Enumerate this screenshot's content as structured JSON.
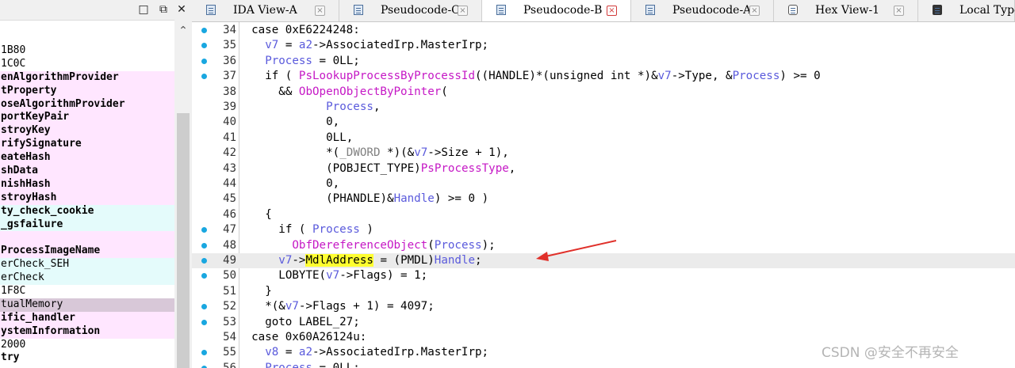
{
  "left_panel": {
    "functions": [
      {
        "name": "1B80",
        "bold": false,
        "bg": ""
      },
      {
        "name": "1C0C",
        "bold": false,
        "bg": ""
      },
      {
        "name": "enAlgorithmProvider",
        "bold": true,
        "bg": "pink"
      },
      {
        "name": "tProperty",
        "bold": true,
        "bg": "pink"
      },
      {
        "name": "oseAlgorithmProvider",
        "bold": true,
        "bg": "pink"
      },
      {
        "name": "portKeyPair",
        "bold": true,
        "bg": "pink"
      },
      {
        "name": "stroyKey",
        "bold": true,
        "bg": "pink"
      },
      {
        "name": "rifySignature",
        "bold": true,
        "bg": "pink"
      },
      {
        "name": "eateHash",
        "bold": true,
        "bg": "pink"
      },
      {
        "name": "shData",
        "bold": true,
        "bg": "pink"
      },
      {
        "name": "nishHash",
        "bold": true,
        "bg": "pink"
      },
      {
        "name": "stroyHash",
        "bold": true,
        "bg": "pink"
      },
      {
        "name": "ty_check_cookie",
        "bold": true,
        "bg": "cyan"
      },
      {
        "name": "_gsfailure",
        "bold": true,
        "bg": "cyan"
      },
      {
        "name": "",
        "bold": true,
        "bg": "pink"
      },
      {
        "name": "ProcessImageName",
        "bold": true,
        "bg": "pink"
      },
      {
        "name": "erCheck_SEH",
        "bold": false,
        "bg": "cyan"
      },
      {
        "name": "erCheck",
        "bold": false,
        "bg": "cyan"
      },
      {
        "name": "1F8C",
        "bold": false,
        "bg": ""
      },
      {
        "name": "tualMemory",
        "bold": false,
        "bg": "sel"
      },
      {
        "name": "ific_handler",
        "bold": true,
        "bg": "pink"
      },
      {
        "name": "ystemInformation",
        "bold": true,
        "bg": "pink"
      },
      {
        "name": "2000",
        "bold": false,
        "bg": ""
      },
      {
        "name": "try",
        "bold": true,
        "bg": ""
      }
    ]
  },
  "tabs": [
    {
      "label": "IDA View-A",
      "icon": "ida-view-icon",
      "active": false,
      "close_red": false
    },
    {
      "label": "Pseudocode-C",
      "icon": "pseudocode-icon",
      "active": false,
      "close_red": false
    },
    {
      "label": "Pseudocode-B",
      "icon": "pseudocode-icon",
      "active": true,
      "close_red": true
    },
    {
      "label": "Pseudocode-A",
      "icon": "pseudocode-icon",
      "active": false,
      "close_red": false
    },
    {
      "label": "Hex View-1",
      "icon": "hex-view-icon",
      "active": false,
      "close_red": false
    },
    {
      "label": "Local Types",
      "icon": "local-types-icon",
      "active": false,
      "close_red": false
    }
  ],
  "code_lines": [
    {
      "n": "34",
      "bp": true,
      "indent": 2,
      "tokens": [
        [
          "",
          "case 0xE6224248:"
        ]
      ]
    },
    {
      "n": "35",
      "bp": true,
      "indent": 4,
      "tokens": [
        [
          "v",
          "v7"
        ],
        [
          "",
          " = "
        ],
        [
          "v",
          "a2"
        ],
        [
          "",
          "->AssociatedIrp.MasterIrp;"
        ]
      ]
    },
    {
      "n": "36",
      "bp": true,
      "indent": 4,
      "tokens": [
        [
          "v",
          "Process"
        ],
        [
          "",
          " = 0LL;"
        ]
      ]
    },
    {
      "n": "37",
      "bp": true,
      "indent": 4,
      "tokens": [
        [
          "",
          "if ( "
        ],
        [
          "p",
          "PsLookupProcessByProcessId"
        ],
        [
          "",
          "((HANDLE)*(unsigned int *)&"
        ],
        [
          "v",
          "v7"
        ],
        [
          "",
          "->Type, &"
        ],
        [
          "v",
          "Process"
        ],
        [
          "",
          ") >= 0"
        ]
      ]
    },
    {
      "n": "38",
      "bp": false,
      "indent": 6,
      "tokens": [
        [
          "",
          "&& "
        ],
        [
          "p",
          "ObOpenObjectByPointer"
        ],
        [
          "",
          "("
        ]
      ]
    },
    {
      "n": "39",
      "bp": false,
      "indent": 13,
      "tokens": [
        [
          "v",
          "Process"
        ],
        [
          "",
          ","
        ]
      ]
    },
    {
      "n": "40",
      "bp": false,
      "indent": 13,
      "tokens": [
        [
          "",
          "0,"
        ]
      ]
    },
    {
      "n": "41",
      "bp": false,
      "indent": 13,
      "tokens": [
        [
          "",
          "0LL,"
        ]
      ]
    },
    {
      "n": "42",
      "bp": false,
      "indent": 13,
      "tokens": [
        [
          "",
          "*("
        ],
        [
          "g",
          "_DWORD"
        ],
        [
          "",
          " *)(&"
        ],
        [
          "v",
          "v7"
        ],
        [
          "",
          "->Size + 1),"
        ]
      ]
    },
    {
      "n": "43",
      "bp": false,
      "indent": 13,
      "tokens": [
        [
          "",
          "(POBJECT_TYPE)"
        ],
        [
          "p",
          "PsProcessType"
        ],
        [
          "",
          ","
        ]
      ]
    },
    {
      "n": "44",
      "bp": false,
      "indent": 13,
      "tokens": [
        [
          "",
          "0,"
        ]
      ]
    },
    {
      "n": "45",
      "bp": false,
      "indent": 13,
      "tokens": [
        [
          "",
          "(PHANDLE)&"
        ],
        [
          "v",
          "Handle"
        ],
        [
          "",
          ") >= 0 )"
        ]
      ]
    },
    {
      "n": "46",
      "bp": false,
      "indent": 4,
      "tokens": [
        [
          "",
          "{"
        ]
      ]
    },
    {
      "n": "47",
      "bp": true,
      "indent": 6,
      "tokens": [
        [
          "",
          "if ( "
        ],
        [
          "v",
          "Process"
        ],
        [
          "",
          " )"
        ]
      ]
    },
    {
      "n": "48",
      "bp": true,
      "indent": 8,
      "tokens": [
        [
          "p",
          "ObfDereferenceObject"
        ],
        [
          "",
          "("
        ],
        [
          "v",
          "Process"
        ],
        [
          "",
          ");"
        ]
      ]
    },
    {
      "n": "49",
      "bp": true,
      "indent": 6,
      "hl": true,
      "tokens": [
        [
          "v",
          "v7"
        ],
        [
          "",
          "->"
        ],
        [
          "kw",
          "MdlAddress"
        ],
        [
          "",
          " = (PMDL)"
        ],
        [
          "v",
          "Handle"
        ],
        [
          "",
          ";"
        ]
      ]
    },
    {
      "n": "50",
      "bp": true,
      "indent": 6,
      "tokens": [
        [
          "",
          "LOBYTE("
        ],
        [
          "v",
          "v7"
        ],
        [
          "",
          "->Flags) = 1;"
        ]
      ]
    },
    {
      "n": "51",
      "bp": false,
      "indent": 4,
      "tokens": [
        [
          "",
          "}"
        ]
      ]
    },
    {
      "n": "52",
      "bp": true,
      "indent": 4,
      "tokens": [
        [
          "",
          "*(&"
        ],
        [
          "v",
          "v7"
        ],
        [
          "",
          "->Flags + 1) = 4097;"
        ]
      ]
    },
    {
      "n": "53",
      "bp": true,
      "indent": 4,
      "tokens": [
        [
          "",
          "goto LABEL_27;"
        ]
      ]
    },
    {
      "n": "54",
      "bp": false,
      "indent": 2,
      "tokens": [
        [
          "",
          "case 0x60A26124u:"
        ]
      ]
    },
    {
      "n": "55",
      "bp": true,
      "indent": 4,
      "tokens": [
        [
          "v",
          "v8"
        ],
        [
          "",
          " = "
        ],
        [
          "v",
          "a2"
        ],
        [
          "",
          "->AssociatedIrp.MasterIrp;"
        ]
      ]
    },
    {
      "n": "56",
      "bp": true,
      "indent": 4,
      "tokens": [
        [
          "v",
          "Process"
        ],
        [
          "",
          " = 0LL;"
        ]
      ]
    }
  ],
  "watermark": "CSDN @安全不再安全",
  "colors": {
    "breakpoint": "#19a7e0",
    "arrow": "#e0302a",
    "highlight": "#ffff30"
  }
}
